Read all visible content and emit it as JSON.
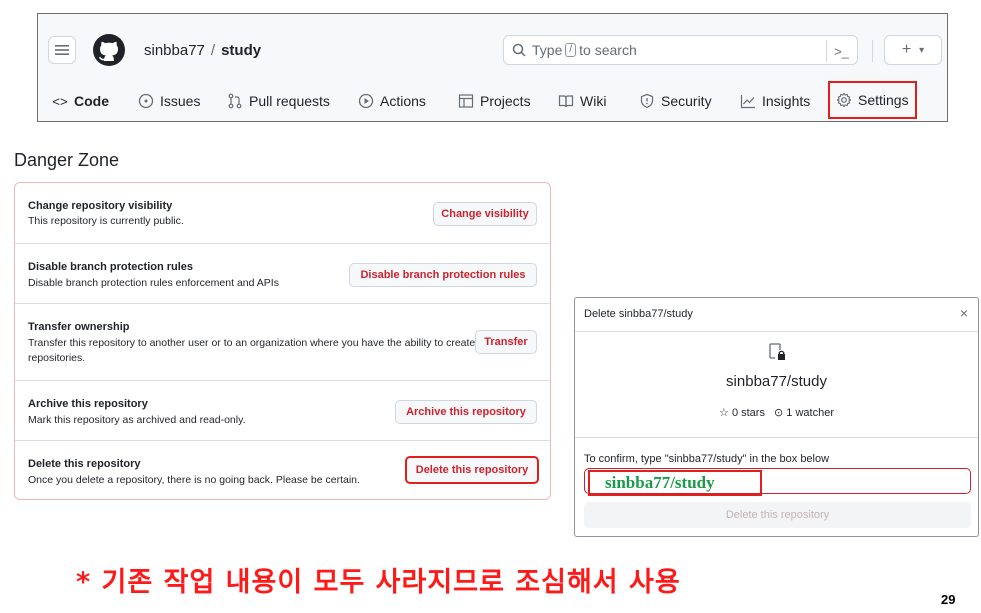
{
  "header": {
    "owner": "sinbba77",
    "separator": "/",
    "repo": "study",
    "search": {
      "prefix": "Type",
      "key": "/",
      "suffix": "to search"
    },
    "command_glyph": ">_",
    "plus_glyph": "+",
    "plus_caret": "▾",
    "tabs": [
      {
        "label": "Code",
        "icon": "code-icon"
      },
      {
        "label": "Issues",
        "icon": "issue-icon"
      },
      {
        "label": "Pull requests",
        "icon": "pull-request-icon"
      },
      {
        "label": "Actions",
        "icon": "play-icon"
      },
      {
        "label": "Projects",
        "icon": "table-icon"
      },
      {
        "label": "Wiki",
        "icon": "book-icon"
      },
      {
        "label": "Security",
        "icon": "shield-icon"
      },
      {
        "label": "Insights",
        "icon": "graph-icon"
      },
      {
        "label": "Settings",
        "icon": "gear-icon"
      }
    ]
  },
  "danger_zone": {
    "title": "Danger Zone",
    "rows": [
      {
        "title": "Change repository visibility",
        "desc": "This repository is currently public.",
        "button": "Change visibility"
      },
      {
        "title": "Disable branch protection rules",
        "desc": "Disable branch protection rules enforcement and APIs",
        "button": "Disable branch protection rules"
      },
      {
        "title": "Transfer ownership",
        "desc": "Transfer this repository to another user or to an organization where you have the ability to create repositories.",
        "button": "Transfer"
      },
      {
        "title": "Archive this repository",
        "desc": "Mark this repository as archived and read-only.",
        "button": "Archive this repository"
      },
      {
        "title": "Delete this repository",
        "desc": "Once you delete a repository, there is no going back. Please be certain.",
        "button": "Delete this repository"
      }
    ]
  },
  "modal": {
    "title": "Delete sinbba77/study",
    "close": "×",
    "repo": "sinbba77/study",
    "stars": "0 stars",
    "watchers": "1 watcher",
    "confirm_label": "To confirm, type \"sinbba77/study\" in the box below",
    "typed_value": "sinbba77/study",
    "delete_button": "Delete this repository"
  },
  "warning": "* 기존 작업 내용이 모두 사라지므로 조심해서 사용",
  "page_number": "29",
  "colors": {
    "danger": "#cf222e",
    "highlight": "#e0201c",
    "typed_text": "#1a9a4a",
    "warning": "#ff1a1a"
  }
}
